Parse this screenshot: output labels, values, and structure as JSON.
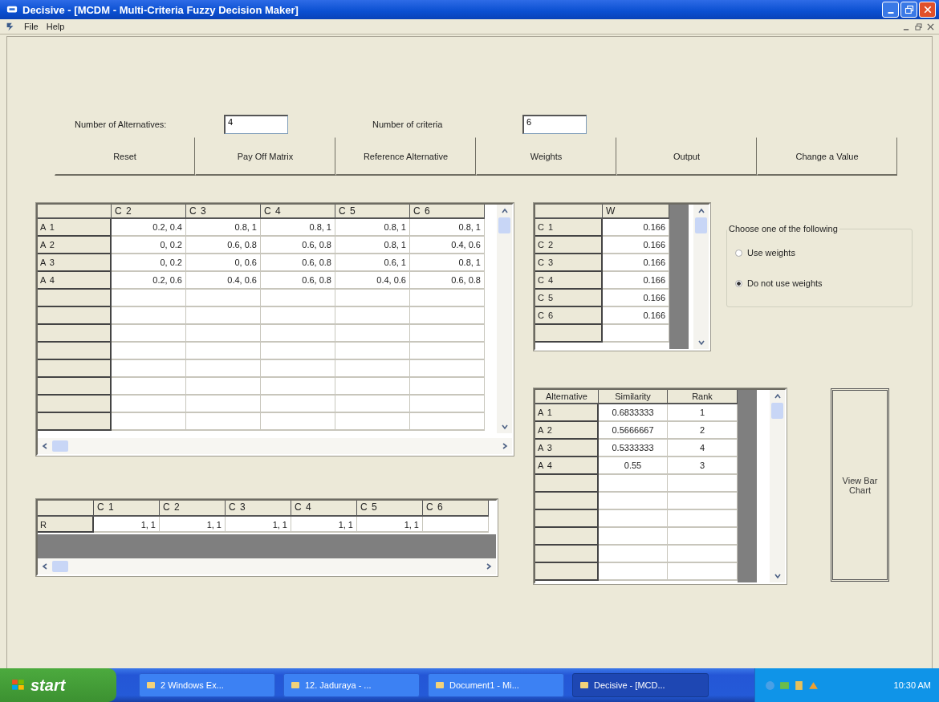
{
  "window": {
    "title": "Decisive - [MCDM - Multi-Criteria Fuzzy Decision Maker]"
  },
  "menu": [
    "File",
    "Help"
  ],
  "inputs": [
    {
      "label": "Number of Alternatives:",
      "value": "4"
    },
    {
      "label": "Number of criteria",
      "value": "6"
    }
  ],
  "buttons": [
    "Reset",
    "Pay Off Matrix",
    "Reference Alternative",
    "Weights",
    "Output",
    "Change a Value"
  ],
  "payoff_table": {
    "columns": [
      "C 2",
      "C 3",
      "C 4",
      "C 5",
      "C 6"
    ],
    "rows": [
      {
        "header": "A 1",
        "cells": [
          "0.2, 0.4",
          "0.8, 1",
          "0.8, 1",
          "0.8, 1",
          "0.8, 1"
        ]
      },
      {
        "header": "A 2",
        "cells": [
          "0, 0.2",
          "0.6, 0.8",
          "0.6, 0.8",
          "0.8, 1",
          "0.4, 0.6"
        ]
      },
      {
        "header": "A 3",
        "cells": [
          "0, 0.2",
          "0, 0.6",
          "0.6, 0.8",
          "0.6, 1",
          "0.8, 1"
        ]
      },
      {
        "header": "A 4",
        "cells": [
          "0.2, 0.6",
          "0.4, 0.6",
          "0.6, 0.8",
          "0.4, 0.6",
          "0.6, 0.8"
        ]
      }
    ]
  },
  "reference_table": {
    "columns": [
      "C 1",
      "C 2",
      "C 3",
      "C 4",
      "C 5",
      "C 6"
    ],
    "rows": [
      {
        "header": "R",
        "cells": [
          "1, 1",
          "1, 1",
          "1, 1",
          "1, 1",
          "1, 1"
        ]
      }
    ]
  },
  "weights_table": {
    "columns": [
      "W"
    ],
    "rows": [
      {
        "header": "C 1",
        "value": "0.166"
      },
      {
        "header": "C 2",
        "value": "0.166"
      },
      {
        "header": "C 3",
        "value": "0.166"
      },
      {
        "header": "C 4",
        "value": "0.166"
      },
      {
        "header": "C 5",
        "value": "0.166"
      },
      {
        "header": "C 6",
        "value": "0.166"
      }
    ]
  },
  "weight_choice": {
    "legend": "Choose one of the following",
    "options": [
      {
        "label": "Use weights",
        "selected": false
      },
      {
        "label": "Do not use weights",
        "selected": true
      }
    ]
  },
  "results_table": {
    "columns": [
      "Alternative",
      "Similarity",
      "Rank"
    ],
    "rows": [
      [
        "A 1",
        "0.6833333",
        "1"
      ],
      [
        "A 2",
        "0.5666667",
        "2"
      ],
      [
        "A 3",
        "0.5333333",
        "4"
      ],
      [
        "A 4",
        "0.55",
        "3"
      ]
    ]
  },
  "chart_button": "View Bar Chart",
  "taskbar": {
    "start": "start",
    "tasks": [
      {
        "label": "2 Windows Ex...",
        "selected": false
      },
      {
        "label": "12. Jaduraya - ...",
        "selected": false
      },
      {
        "label": "Document1 - Mi...",
        "selected": false
      },
      {
        "label": "Decisive - [MCD...",
        "selected": true
      }
    ],
    "clock": "10:30 AM"
  }
}
